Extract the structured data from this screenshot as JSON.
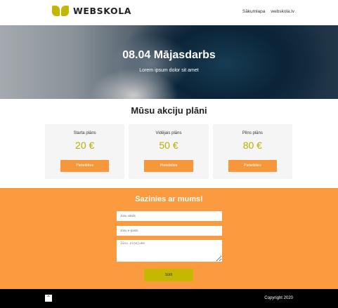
{
  "header": {
    "logo_text": "WEBSKOLA",
    "nav": [
      "Sākumlapa",
      "webskola.lv"
    ]
  },
  "hero": {
    "title": "08.04 Mājasdarbs",
    "subtitle": "Lorem ipsum dolor sit amet"
  },
  "plans": {
    "title": "Mūsu akciju plāni",
    "items": [
      {
        "name": "Starta plāns",
        "price": "20 €",
        "button": "Pieteikties"
      },
      {
        "name": "Vidējais plāns",
        "price": "50 €",
        "button": "Pieteikties"
      },
      {
        "name": "Pilns plāns",
        "price": "80 €",
        "button": "Pieteikties"
      }
    ]
  },
  "contact": {
    "title": "Sazinies ar mums!",
    "name_placeholder": "Jūsu vārds",
    "email_placeholder": "Jūsu e-pasts",
    "message_placeholder": "Jūsu ziņojums",
    "send_label": "Sūtīt"
  },
  "footer": {
    "top_icon": "chevron-up-icon",
    "top_glyph": "^",
    "copyright": "Copyright 2020"
  },
  "colors": {
    "accent_orange": "#fb9a3e",
    "accent_olive": "#c5b800",
    "footer_bg": "#000000"
  }
}
